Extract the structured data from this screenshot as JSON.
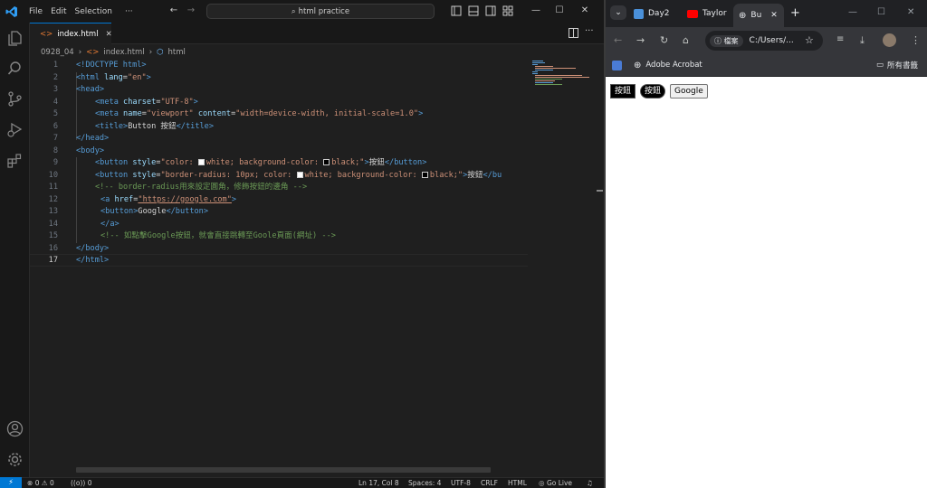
{
  "vscode": {
    "menu": [
      "File",
      "Edit",
      "Selection",
      "···"
    ],
    "search_text": "html practice",
    "tab_label": "index.html",
    "breadcrumb": [
      "0928_04",
      "index.html",
      "html"
    ],
    "lines": [
      "1",
      "2",
      "3",
      "4",
      "5",
      "6",
      "7",
      "8",
      "9",
      "10",
      "11",
      "12",
      "13",
      "14",
      "15",
      "16",
      "17"
    ],
    "status": {
      "errors": "0",
      "warnings": "0",
      "ports": "0",
      "position": "Ln 17, Col 8",
      "spaces": "Spaces: 4",
      "encoding": "UTF-8",
      "eol": "CRLF",
      "language": "HTML",
      "golive": "Go Live"
    },
    "code": {
      "l1": "<!DOCTYPE html>",
      "l2_tag": "<html ",
      "l2_attr": "lang",
      "l2_val": "\"en\"",
      "l2_end": ">",
      "l3": "<head>",
      "l4_tag": "<meta ",
      "l4_attr": "charset",
      "l4_val": "\"UTF-8\"",
      "l4_end": ">",
      "l5_tag": "<meta ",
      "l5_attr1": "name",
      "l5_val1": "\"viewport\"",
      "l5_attr2": "content",
      "l5_val2": "\"width=device-width, initial-scale=1.0\"",
      "l5_end": ">",
      "l6_tag": "<title>",
      "l6_text": "Button 按鈕",
      "l6_end": "</title>",
      "l7": "</head>",
      "l8": "<body>",
      "l9_tag": "<button ",
      "l9_attr": "style",
      "l9_val_a": "\"color: ",
      "l9_val_b": "white; background-color: ",
      "l9_val_c": "black;\"",
      "l9_gt": ">",
      "l9_text": "按鈕",
      "l9_end": "</button>",
      "l10_tag": "<button ",
      "l10_attr": "style",
      "l10_val_a": "\"border-radius: 10px; color: ",
      "l10_val_b": "white; background-color: ",
      "l10_val_c": "black;\"",
      "l10_gt": ">",
      "l10_text": "按鈕",
      "l10_end": "</bu",
      "l11": "<!-- border-radius用來設定圓角，修飾按鈕的邊角 -->",
      "l12_tag": "<a ",
      "l12_attr": "href",
      "l12_eq": "=",
      "l12_val": "\"https://google.com\"",
      "l12_end": ">",
      "l13_tag": "<button>",
      "l13_text": "Google",
      "l13_end": "</button>",
      "l14": "</a>",
      "l15": "<!-- 如點擊Google按鈕，就會直接跳轉至Goole頁面(網址) -->",
      "l16": "</body>",
      "l17": "</html>"
    }
  },
  "chrome": {
    "tabs": [
      "Day2",
      "Taylor",
      "Bu"
    ],
    "address_label": "檔案",
    "address": "C:/Users/...",
    "bookmark": "Adobe Acrobat",
    "all_bookmarks": "所有書籤",
    "page_buttons": [
      "按鈕",
      "按鈕",
      "Google"
    ]
  },
  "colors": {
    "accent": "#0078d4",
    "editor_bg": "#1f1f1f",
    "chrome_dark": "#202124"
  }
}
